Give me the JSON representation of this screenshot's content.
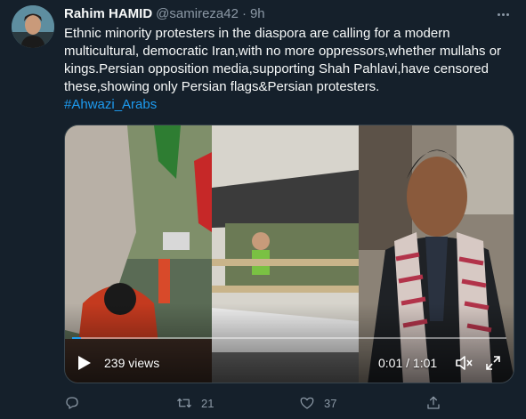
{
  "tweet": {
    "author_name": "Rahim HAMID",
    "author_handle": "@samireza42",
    "separator": "·",
    "time": "9h",
    "text_lines": [
      "Ethnic minority protesters in the diaspora are calling for a modern",
      "multicultural, democratic Iran,with no more oppressors,whether mullahs or",
      "kings.Persian opposition media,supporting Shah Pahlavi,have censored",
      "these,showing only Persian flags&Persian protesters."
    ],
    "hashtag": "#Ahwazi_Arabs"
  },
  "video": {
    "views": "239 views",
    "time_display": "0:01 / 1:01",
    "progress": 0.02,
    "icons": [
      "play-icon",
      "volume-icon",
      "fullscreen-icon"
    ]
  },
  "actions": {
    "reply_count": "",
    "retweet_count": "21",
    "like_count": "37",
    "icons": [
      "reply-icon",
      "retweet-icon",
      "like-icon",
      "share-icon"
    ]
  },
  "colors": {
    "background": "#15202b",
    "text": "#f7f9f9",
    "secondary": "#8b98a5",
    "accent": "#1d9bf0"
  }
}
